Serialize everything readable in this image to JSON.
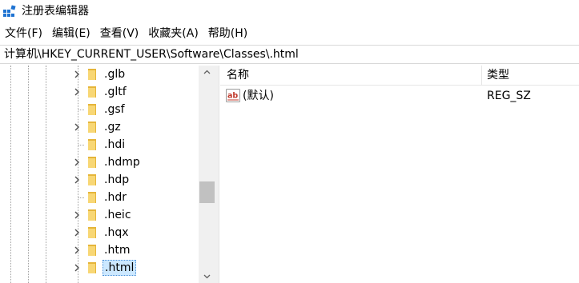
{
  "window": {
    "title": "注册表编辑器",
    "icon": "regedit-icon"
  },
  "menu": {
    "items": [
      {
        "label": "文件(F)"
      },
      {
        "label": "编辑(E)"
      },
      {
        "label": "查看(V)"
      },
      {
        "label": "收藏夹(A)"
      },
      {
        "label": "帮助(H)"
      }
    ]
  },
  "address": {
    "path": "计算机\\HKEY_CURRENT_USER\\Software\\Classes\\.html"
  },
  "tree": {
    "items": [
      {
        "label": ".glb",
        "expandable": true,
        "selected": false
      },
      {
        "label": ".gltf",
        "expandable": true,
        "selected": false
      },
      {
        "label": ".gsf",
        "expandable": false,
        "selected": false
      },
      {
        "label": ".gz",
        "expandable": true,
        "selected": false
      },
      {
        "label": ".hdi",
        "expandable": false,
        "selected": false
      },
      {
        "label": ".hdmp",
        "expandable": true,
        "selected": false
      },
      {
        "label": ".hdp",
        "expandable": true,
        "selected": false
      },
      {
        "label": ".hdr",
        "expandable": false,
        "selected": false
      },
      {
        "label": ".heic",
        "expandable": true,
        "selected": false
      },
      {
        "label": ".hqx",
        "expandable": true,
        "selected": false
      },
      {
        "label": ".htm",
        "expandable": true,
        "selected": false
      },
      {
        "label": ".html",
        "expandable": true,
        "selected": true
      }
    ]
  },
  "values": {
    "columns": {
      "name": "名称",
      "type": "类型"
    },
    "rows": [
      {
        "name": "(默认)",
        "type": "REG_SZ",
        "icon": "string-value-icon"
      }
    ]
  },
  "colors": {
    "selection": "#cce8ff",
    "folder": "#f8d775",
    "folder_dark": "#e5b53a",
    "icon_blue": "#1e73d2"
  }
}
